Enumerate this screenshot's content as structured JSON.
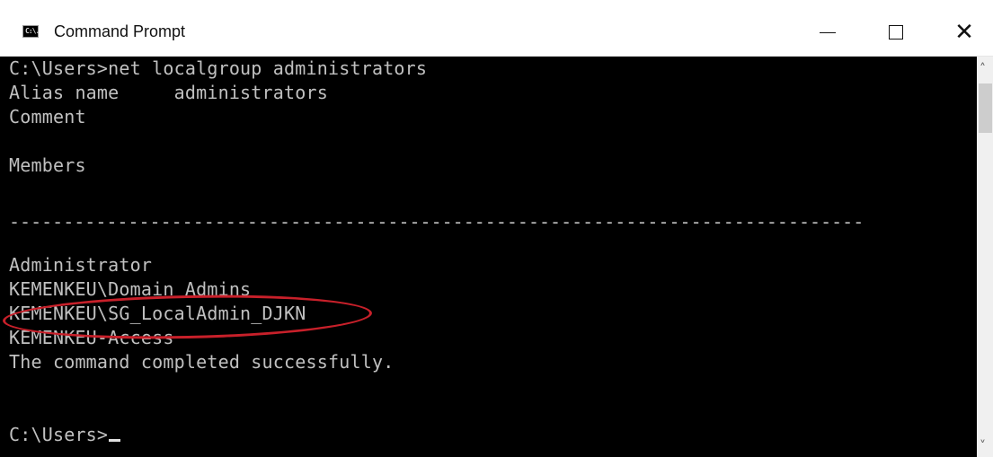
{
  "window": {
    "title": "Command Prompt",
    "icon_name": "cmd-icon",
    "icon_text": "C:\\."
  },
  "controls": {
    "minimize_icon": "minimize-icon",
    "maximize_icon": "maximize-icon",
    "close_icon": "close-icon",
    "close_glyph": "✕"
  },
  "console": {
    "lines": [
      "C:\\Users>net localgroup administrators",
      "Alias name     administrators",
      "Comment",
      "",
      "Members",
      "",
      "-------------------------------------------------------------------------------",
      "",
      "Administrator",
      "KEMENKEU\\Domain Admins",
      "KEMENKEU\\SG_LocalAdmin_DJKN",
      "KEMENKEU-Access",
      "The command completed successfully.",
      "",
      "",
      "C:\\Users>"
    ],
    "highlighted_member": "KEMENKEU\\SG_LocalAdmin_DJKN",
    "annotation_color": "#c8202a"
  },
  "scrollbar": {
    "up_glyph": "˄",
    "down_glyph": "˅"
  }
}
